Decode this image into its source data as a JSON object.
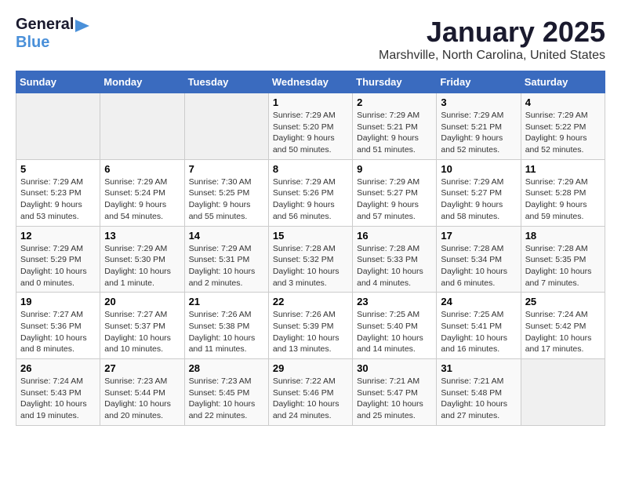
{
  "header": {
    "logo_general": "General",
    "logo_blue": "Blue",
    "title": "January 2025",
    "subtitle": "Marshville, North Carolina, United States"
  },
  "days_of_week": [
    "Sunday",
    "Monday",
    "Tuesday",
    "Wednesday",
    "Thursday",
    "Friday",
    "Saturday"
  ],
  "weeks": [
    {
      "days": [
        {
          "num": "",
          "empty": true
        },
        {
          "num": "",
          "empty": true
        },
        {
          "num": "",
          "empty": true
        },
        {
          "num": "1",
          "info": "Sunrise: 7:29 AM\nSunset: 5:20 PM\nDaylight: 9 hours\nand 50 minutes."
        },
        {
          "num": "2",
          "info": "Sunrise: 7:29 AM\nSunset: 5:21 PM\nDaylight: 9 hours\nand 51 minutes."
        },
        {
          "num": "3",
          "info": "Sunrise: 7:29 AM\nSunset: 5:21 PM\nDaylight: 9 hours\nand 52 minutes."
        },
        {
          "num": "4",
          "info": "Sunrise: 7:29 AM\nSunset: 5:22 PM\nDaylight: 9 hours\nand 52 minutes."
        }
      ]
    },
    {
      "days": [
        {
          "num": "5",
          "info": "Sunrise: 7:29 AM\nSunset: 5:23 PM\nDaylight: 9 hours\nand 53 minutes."
        },
        {
          "num": "6",
          "info": "Sunrise: 7:29 AM\nSunset: 5:24 PM\nDaylight: 9 hours\nand 54 minutes."
        },
        {
          "num": "7",
          "info": "Sunrise: 7:30 AM\nSunset: 5:25 PM\nDaylight: 9 hours\nand 55 minutes."
        },
        {
          "num": "8",
          "info": "Sunrise: 7:29 AM\nSunset: 5:26 PM\nDaylight: 9 hours\nand 56 minutes."
        },
        {
          "num": "9",
          "info": "Sunrise: 7:29 AM\nSunset: 5:27 PM\nDaylight: 9 hours\nand 57 minutes."
        },
        {
          "num": "10",
          "info": "Sunrise: 7:29 AM\nSunset: 5:27 PM\nDaylight: 9 hours\nand 58 minutes."
        },
        {
          "num": "11",
          "info": "Sunrise: 7:29 AM\nSunset: 5:28 PM\nDaylight: 9 hours\nand 59 minutes."
        }
      ]
    },
    {
      "days": [
        {
          "num": "12",
          "info": "Sunrise: 7:29 AM\nSunset: 5:29 PM\nDaylight: 10 hours\nand 0 minutes."
        },
        {
          "num": "13",
          "info": "Sunrise: 7:29 AM\nSunset: 5:30 PM\nDaylight: 10 hours\nand 1 minute."
        },
        {
          "num": "14",
          "info": "Sunrise: 7:29 AM\nSunset: 5:31 PM\nDaylight: 10 hours\nand 2 minutes."
        },
        {
          "num": "15",
          "info": "Sunrise: 7:28 AM\nSunset: 5:32 PM\nDaylight: 10 hours\nand 3 minutes."
        },
        {
          "num": "16",
          "info": "Sunrise: 7:28 AM\nSunset: 5:33 PM\nDaylight: 10 hours\nand 4 minutes."
        },
        {
          "num": "17",
          "info": "Sunrise: 7:28 AM\nSunset: 5:34 PM\nDaylight: 10 hours\nand 6 minutes."
        },
        {
          "num": "18",
          "info": "Sunrise: 7:28 AM\nSunset: 5:35 PM\nDaylight: 10 hours\nand 7 minutes."
        }
      ]
    },
    {
      "days": [
        {
          "num": "19",
          "info": "Sunrise: 7:27 AM\nSunset: 5:36 PM\nDaylight: 10 hours\nand 8 minutes."
        },
        {
          "num": "20",
          "info": "Sunrise: 7:27 AM\nSunset: 5:37 PM\nDaylight: 10 hours\nand 10 minutes."
        },
        {
          "num": "21",
          "info": "Sunrise: 7:26 AM\nSunset: 5:38 PM\nDaylight: 10 hours\nand 11 minutes."
        },
        {
          "num": "22",
          "info": "Sunrise: 7:26 AM\nSunset: 5:39 PM\nDaylight: 10 hours\nand 13 minutes."
        },
        {
          "num": "23",
          "info": "Sunrise: 7:25 AM\nSunset: 5:40 PM\nDaylight: 10 hours\nand 14 minutes."
        },
        {
          "num": "24",
          "info": "Sunrise: 7:25 AM\nSunset: 5:41 PM\nDaylight: 10 hours\nand 16 minutes."
        },
        {
          "num": "25",
          "info": "Sunrise: 7:24 AM\nSunset: 5:42 PM\nDaylight: 10 hours\nand 17 minutes."
        }
      ]
    },
    {
      "days": [
        {
          "num": "26",
          "info": "Sunrise: 7:24 AM\nSunset: 5:43 PM\nDaylight: 10 hours\nand 19 minutes."
        },
        {
          "num": "27",
          "info": "Sunrise: 7:23 AM\nSunset: 5:44 PM\nDaylight: 10 hours\nand 20 minutes."
        },
        {
          "num": "28",
          "info": "Sunrise: 7:23 AM\nSunset: 5:45 PM\nDaylight: 10 hours\nand 22 minutes."
        },
        {
          "num": "29",
          "info": "Sunrise: 7:22 AM\nSunset: 5:46 PM\nDaylight: 10 hours\nand 24 minutes."
        },
        {
          "num": "30",
          "info": "Sunrise: 7:21 AM\nSunset: 5:47 PM\nDaylight: 10 hours\nand 25 minutes."
        },
        {
          "num": "31",
          "info": "Sunrise: 7:21 AM\nSunset: 5:48 PM\nDaylight: 10 hours\nand 27 minutes."
        },
        {
          "num": "",
          "empty": true
        }
      ]
    }
  ]
}
